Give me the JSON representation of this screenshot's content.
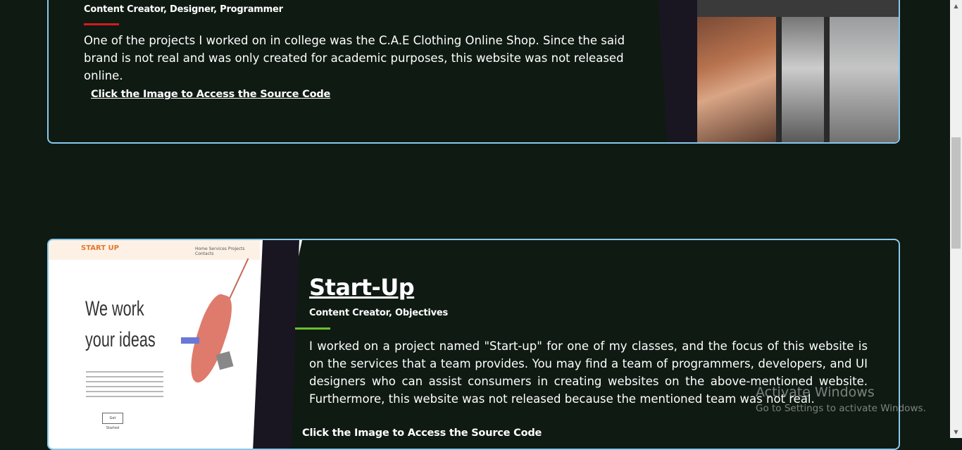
{
  "project1": {
    "roles": "Content Creator, Designer, Programmer",
    "description": "One of the projects I worked on in college was the C.A.E Clothing Online Shop. Since the said brand is not real and was only created for academic purposes, this website was not released online.",
    "source_link": "Click the Image to Access the Source Code",
    "accent_color": "#d21c1c"
  },
  "project2": {
    "title": "Start-Up",
    "roles": "Content Creator, Objectives",
    "description": "I worked on a project named \"Start-up\" for one of my classes, and the focus of this website is on the services that a team provides. You may find a team of programmers, developers, and UI designers who can assist consumers in creating websites on the above-mentioned website. Furthermore, this website was not released because the mentioned team was not real.",
    "source_link": "Click the Image to Access the Source Code",
    "accent_color": "#6abf2d",
    "preview": {
      "logo": "START UP",
      "nav_links": "Home  Services  Projects  Contacts",
      "headline_1": "We work",
      "headline_2": "your ideas",
      "button": "Get Started"
    }
  },
  "watermark": {
    "title": "Activate Windows",
    "subtitle": "Go to Settings to activate Windows."
  },
  "colors": {
    "background": "#0f1a13",
    "card_border": "#89c8ea"
  },
  "icons": {
    "scroll_up": "triangle-up-icon",
    "scroll_down": "triangle-down-icon"
  }
}
